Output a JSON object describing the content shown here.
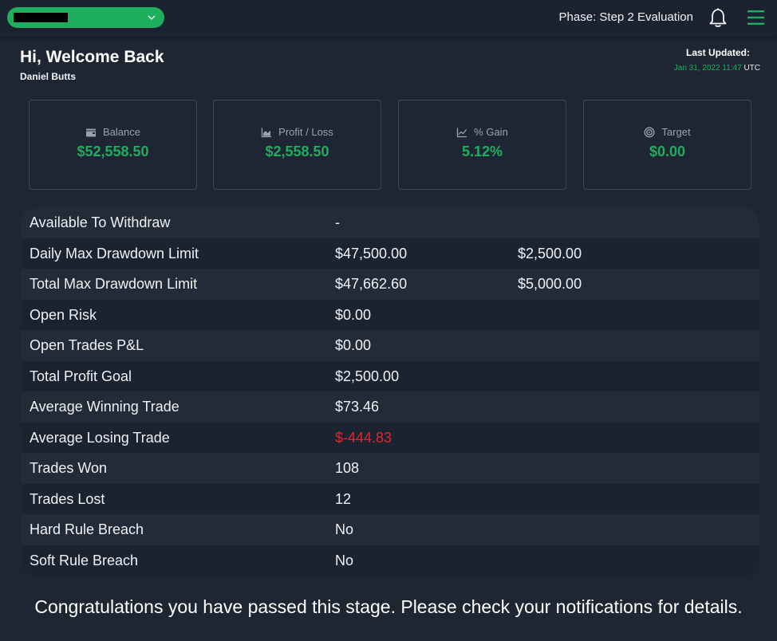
{
  "header": {
    "phase_text": "Phase: Step 2 Evaluation"
  },
  "welcome": {
    "title": "Hi, Welcome Back",
    "username": "Daniel Butts",
    "last_updated_label": "Last Updated:",
    "last_updated_date": "Jan 31, 2022 11:47",
    "last_updated_tz": "UTC"
  },
  "cards": [
    {
      "label": "Balance",
      "value": "$52,558.50",
      "icon": "wallet-icon"
    },
    {
      "label": "Profit / Loss",
      "value": "$2,558.50",
      "icon": "area-chart-icon"
    },
    {
      "label": "% Gain",
      "value": "5.12%",
      "icon": "line-chart-icon"
    },
    {
      "label": "Target",
      "value": "$0.00",
      "icon": "target-icon"
    }
  ],
  "stats": [
    {
      "label": "Available To Withdraw",
      "value": "-",
      "extra": ""
    },
    {
      "label": "Daily Max Drawdown Limit",
      "value": "$47,500.00",
      "extra": "$2,500.00"
    },
    {
      "label": "Total Max Drawdown Limit",
      "value": "$47,662.60",
      "extra": "$5,000.00"
    },
    {
      "label": "Open Risk",
      "value": "$0.00",
      "extra": ""
    },
    {
      "label": "Open Trades P&L",
      "value": "$0.00",
      "extra": ""
    },
    {
      "label": "Total Profit Goal",
      "value": "$2,500.00",
      "extra": ""
    },
    {
      "label": "Average Winning Trade",
      "value": "$73.46",
      "extra": ""
    },
    {
      "label": "Average Losing Trade",
      "value": "$-444.83",
      "extra": ""
    },
    {
      "label": "Trades Won",
      "value": "108",
      "extra": ""
    },
    {
      "label": "Trades Lost",
      "value": "12",
      "extra": ""
    },
    {
      "label": "Hard Rule Breach",
      "value": "No",
      "extra": ""
    },
    {
      "label": "Soft Rule Breach",
      "value": "No",
      "extra": ""
    }
  ],
  "footer": {
    "message": "Congratulations you have passed this stage. Please check your notifications for details."
  },
  "colors": {
    "accent_green": "#1fad5e",
    "negative_red": "#e3262b",
    "background": "#1f2633"
  }
}
